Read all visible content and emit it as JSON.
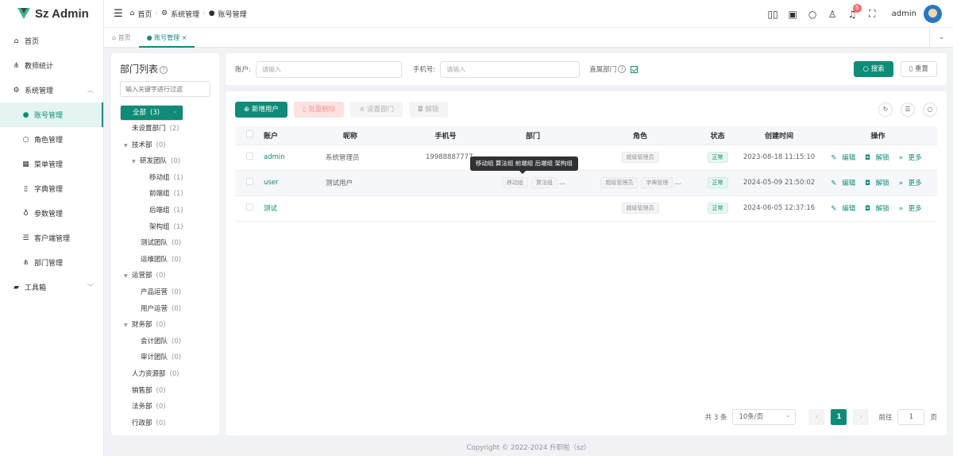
{
  "app": {
    "title": "Sz Admin"
  },
  "sidebar": {
    "items": [
      {
        "label": "首页",
        "icon": "home-icon"
      },
      {
        "label": "教师统计",
        "icon": "chart-icon"
      },
      {
        "label": "系统管理",
        "icon": "gear-icon"
      },
      {
        "label": "账号管理",
        "icon": "user-icon"
      },
      {
        "label": "角色管理",
        "icon": "person-icon"
      },
      {
        "label": "菜单管理",
        "icon": "grid-icon"
      },
      {
        "label": "字典管理",
        "icon": "book-icon"
      },
      {
        "label": "参数管理",
        "icon": "gauge-icon"
      },
      {
        "label": "客户端管理",
        "icon": "sliders-icon"
      },
      {
        "label": "部门管理",
        "icon": "org-icon"
      },
      {
        "label": "工具箱",
        "icon": "briefcase-icon"
      }
    ]
  },
  "header": {
    "breadcrumb": [
      "首页",
      "系统管理",
      "账号管理"
    ],
    "username": "admin",
    "notification_count": "5"
  },
  "tabs": [
    "首页",
    "账号管理"
  ],
  "dept_panel": {
    "title": "部门列表",
    "filter_placeholder": "输入关键字进行过滤",
    "tree": [
      {
        "label": "全部",
        "count": "(3)"
      },
      {
        "label": "未设置部门",
        "count": "(2)"
      },
      {
        "label": "技术部",
        "count": "(0)"
      },
      {
        "label": "研发团队",
        "count": "(0)"
      },
      {
        "label": "移动组",
        "count": "(1)"
      },
      {
        "label": "前端组",
        "count": "(1)"
      },
      {
        "label": "后端组",
        "count": "(1)"
      },
      {
        "label": "架构组",
        "count": "(1)"
      },
      {
        "label": "测试团队",
        "count": "(0)"
      },
      {
        "label": "运维团队",
        "count": "(0)"
      },
      {
        "label": "运营部",
        "count": "(0)"
      },
      {
        "label": "产品运营",
        "count": "(0)"
      },
      {
        "label": "用户运营",
        "count": "(0)"
      },
      {
        "label": "财务部",
        "count": "(0)"
      },
      {
        "label": "会计团队",
        "count": "(0)"
      },
      {
        "label": "审计团队",
        "count": "(0)"
      },
      {
        "label": "人力资源部",
        "count": "(0)"
      },
      {
        "label": "销售部",
        "count": "(0)"
      },
      {
        "label": "法务部",
        "count": "(0)"
      },
      {
        "label": "行政部",
        "count": "(0)"
      }
    ]
  },
  "search": {
    "account_label": "账户:",
    "account_placeholder": "请输入",
    "phone_label": "手机号:",
    "phone_placeholder": "请输入",
    "direct_dept_label": "直属部门",
    "search_btn": "搜索",
    "reset_btn": "重置"
  },
  "toolbar": {
    "add": "新增用户",
    "batch_delete": "批量删除",
    "set_dept": "设置部门",
    "unlock": "解锁"
  },
  "table": {
    "columns": [
      "账户",
      "昵称",
      "手机号",
      "部门",
      "角色",
      "状态",
      "创建时间",
      "操作"
    ],
    "rows": [
      {
        "account": "admin",
        "nickname": "系统管理员",
        "phone": "19988887777",
        "depts": [],
        "roles": [
          "超级管理员"
        ],
        "status": "正常",
        "created": "2023-08-18 11:15:10"
      },
      {
        "account": "user",
        "nickname": "测试用户",
        "phone": "",
        "depts": [
          "移动组",
          "算法组",
          "..."
        ],
        "roles": [
          "超级管理员",
          "字典管理",
          "..."
        ],
        "status": "正常",
        "created": "2024-05-09 21:50:02"
      },
      {
        "account": "测试",
        "nickname": "",
        "phone": "",
        "depts": [],
        "roles": [
          "超级管理员"
        ],
        "status": "正常",
        "created": "2024-06-05 12:37:16"
      }
    ],
    "ops": {
      "edit": "编辑",
      "unlock": "解锁",
      "more": "更多"
    }
  },
  "tooltip": "移动组 算法组 前端组 后端组 架构组",
  "pager": {
    "total": "共 3 条",
    "page_size": "10条/页",
    "current": "1",
    "goto": "前往",
    "goto_value": "1",
    "page_suffix": "页"
  },
  "footer": "Copyright © 2022-2024 升职啦（sz）",
  "colors": {
    "primary": "#0e8c78",
    "danger": "#f56c6c"
  }
}
